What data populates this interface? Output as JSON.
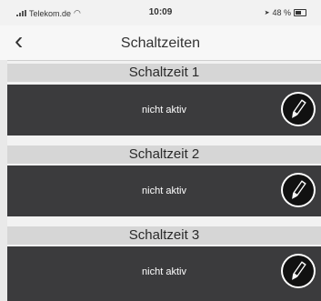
{
  "status_bar": {
    "carrier": "Telekom.de",
    "time": "10:09",
    "battery_percent": "48 %"
  },
  "nav": {
    "back_icon": "chevron-left-icon",
    "title": "Schaltzeiten"
  },
  "schedules": [
    {
      "header": "Schaltzeit 1",
      "status": "nicht aktiv",
      "edit_icon": "pencil-icon"
    },
    {
      "header": "Schaltzeit 2",
      "status": "nicht aktiv",
      "edit_icon": "pencil-icon"
    },
    {
      "header": "Schaltzeit 3",
      "status": "nicht aktiv",
      "edit_icon": "pencil-icon"
    }
  ],
  "colors": {
    "row_background": "#3b3b3d",
    "section_header_background": "#d6d6d6"
  }
}
